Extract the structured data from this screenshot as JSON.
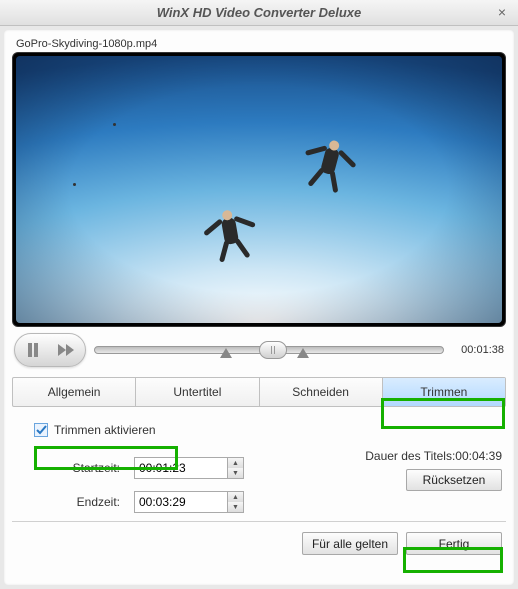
{
  "window": {
    "title": "WinX HD Video Converter Deluxe"
  },
  "file": {
    "name": "GoPro-Skydiving-1080p.mp4"
  },
  "playback": {
    "current_time": "00:01:38"
  },
  "tabs": {
    "items": [
      {
        "label": "Allgemein"
      },
      {
        "label": "Untertitel"
      },
      {
        "label": "Schneiden"
      },
      {
        "label": "Trimmen"
      }
    ],
    "active_index": 3
  },
  "trim": {
    "enable_label": "Trimmen aktivieren",
    "enabled": true,
    "start_label": "Startzeit:",
    "start_value": "00:01:23",
    "end_label": "Endzeit:",
    "end_value": "00:03:29",
    "duration_label": "Dauer des Titels:",
    "duration_value": "00:04:39",
    "reset_label": "Rücksetzen"
  },
  "footer": {
    "apply_all": "Für alle gelten",
    "done": "Fertig"
  },
  "icons": {
    "close": "×",
    "pause": "❙❙",
    "fast_forward": "▶▶",
    "spin_up": "▲",
    "spin_down": "▼"
  }
}
